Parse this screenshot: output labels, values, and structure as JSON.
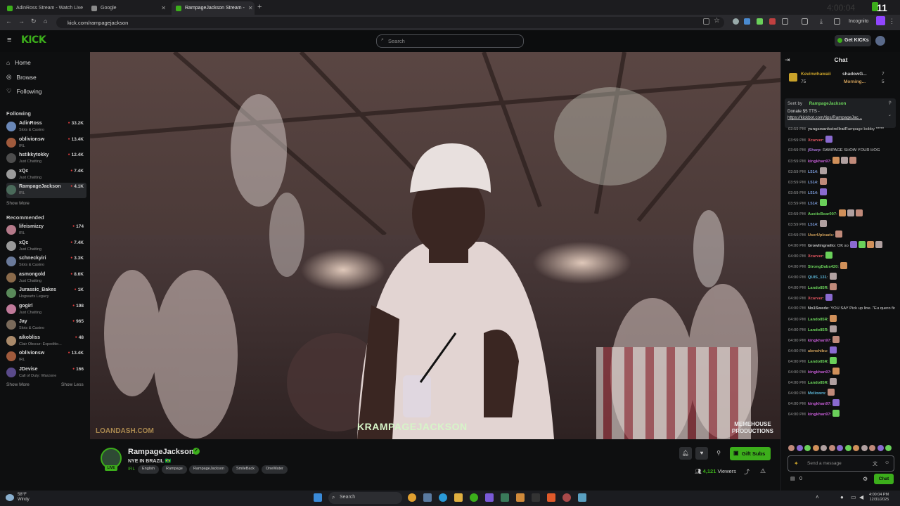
{
  "browser": {
    "tabs": [
      {
        "title": "AdinRoss Stream - Watch Live",
        "active": false,
        "favicon_color": "#3cae1b"
      },
      {
        "title": "Google",
        "active": false,
        "favicon_color": "#8a8a8a"
      },
      {
        "title": "RampageJackson Stream - ",
        "active": true,
        "favicon_color": "#3cae1b"
      }
    ],
    "url": "kick.com/rampagejackson",
    "incognito_label": "Incognito",
    "overlay_number": "11",
    "overlay_clock": "4:00:04"
  },
  "header": {
    "logo": "KICK",
    "search_placeholder": "Search",
    "get_kicks_label": "Get KICKs"
  },
  "sidebar": {
    "nav": [
      {
        "label": "Home",
        "icon": "home-icon"
      },
      {
        "label": "Browse",
        "icon": "browse-icon"
      },
      {
        "label": "Following",
        "icon": "heart-icon"
      }
    ],
    "following_title": "Following",
    "following": [
      {
        "name": "AdinRoss",
        "category": "Slots & Casino",
        "viewers": "33.2K",
        "color": "#6a88b8"
      },
      {
        "name": "oblivionsw",
        "category": "IRL",
        "viewers": "13.4K",
        "color": "#a05a3c"
      },
      {
        "name": "hstikkytokky",
        "category": "Just Chatting",
        "viewers": "12.4K",
        "color": "#4d4d4d"
      },
      {
        "name": "xQc",
        "category": "Just Chatting",
        "viewers": "7.4K",
        "color": "#9a9a9a"
      },
      {
        "name": "RampageJackson",
        "category": "IRL",
        "viewers": "4.1K",
        "color": "#4a6a5a"
      }
    ],
    "show_more": "Show More",
    "recommended_title": "Recommended",
    "recommended": [
      {
        "name": "lifeismizzy",
        "category": "IRL",
        "viewers": "174",
        "color": "#b57a8a"
      },
      {
        "name": "xQc",
        "category": "Just Chatting",
        "viewers": "7.4K",
        "color": "#9a9a9a"
      },
      {
        "name": "schneckyiri",
        "category": "Slots & Casino",
        "viewers": "3.3K",
        "color": "#6a7a9a"
      },
      {
        "name": "asmongold",
        "category": "Just Chatting",
        "viewers": "8.6K",
        "color": "#8a6a4a"
      },
      {
        "name": "Jurassic_Bakes",
        "category": "Hogwarts Legacy",
        "viewers": "1K",
        "color": "#5a8a5a"
      },
      {
        "name": "gogirl",
        "category": "Just Chatting",
        "viewers": "198",
        "color": "#c07a9a"
      },
      {
        "name": "Jay",
        "category": "Slots & Casino",
        "viewers": "965",
        "color": "#7a6a5a"
      },
      {
        "name": "aikobliss",
        "category": "Clair Obscur: Expeditio...",
        "viewers": "48",
        "color": "#aa8a6a"
      },
      {
        "name": "oblivionsw",
        "category": "IRL",
        "viewers": "13.4K",
        "color": "#a05a3c"
      },
      {
        "name": "JDevise",
        "category": "Call of Duty: Warzone",
        "viewers": "166",
        "color": "#5a4a8a"
      }
    ],
    "show_more_2": "Show More",
    "show_less": "Show Less"
  },
  "video": {
    "watermark_left": "LOANDASH.COM",
    "banner_center": "KRAMPAGEJACKSON",
    "watermark_right_line1": "MEMEHOUSE",
    "watermark_right_line2": "PRODUCTIONS"
  },
  "stream": {
    "name": "RampageJackson",
    "live_label": "LIVE",
    "title": "NYE IN BRAZIL 🇧🇷",
    "category": "IRL",
    "tags": [
      "English",
      "Rampage",
      "RampageJackson",
      "SmileBack",
      "OneWater"
    ],
    "gift_subs_label": "Gift Subs",
    "viewers_count": "4,121",
    "viewers_label": "Viewers"
  },
  "chat": {
    "title": "Chat",
    "pinned": {
      "user1": "Kevinwhawaii",
      "user1_count": "75",
      "user1_value": "7",
      "user2": "shadowG...",
      "user3": "Morning...",
      "user3_value": "5"
    },
    "tts": {
      "sent_by": "Sent by",
      "sender": "RampageJackson",
      "line1": "Donate $5 TTS -",
      "link": "https://kickbot.com/tips/RampageJac..."
    },
    "messages": [
      {
        "time": "03:59 PM",
        "user": "yungswankstrellrat",
        "text": "Rampage bobby *****",
        "color": "#bdbdbd",
        "emotes": 0
      },
      {
        "time": "03:59 PM",
        "user": "Xcarver",
        "text": ":",
        "color": "#e0545e",
        "emotes": 1
      },
      {
        "time": "03:59 PM",
        "user": "jSharp",
        "text": ": RAMPAGE SHOW YOUR HOG",
        "color": "#a070d0",
        "emotes": 0
      },
      {
        "time": "03:59 PM",
        "user": "kingkhan97",
        "text": ":",
        "color": "#c05ad0",
        "emotes": 3
      },
      {
        "time": "03:59 PM",
        "user": "L514",
        "text": ":",
        "color": "#7a9ad8",
        "emotes": 1
      },
      {
        "time": "03:59 PM",
        "user": "L514",
        "text": ":",
        "color": "#7a9ad8",
        "emotes": 1
      },
      {
        "time": "03:59 PM",
        "user": "L514",
        "text": ":",
        "color": "#7a9ad8",
        "emotes": 1
      },
      {
        "time": "03:59 PM",
        "user": "L514",
        "text": ":",
        "color": "#7a9ad8",
        "emotes": 1
      },
      {
        "time": "03:59 PM",
        "user": "AusticBear007",
        "text": ":",
        "color": "#6ad05a",
        "emotes": 3
      },
      {
        "time": "03:59 PM",
        "user": "L514",
        "text": ":",
        "color": "#7a9ad8",
        "emotes": 1
      },
      {
        "time": "03:59 PM",
        "user": "UserUploads",
        "text": ":",
        "color": "#d0a05a",
        "emotes": 1
      },
      {
        "time": "04:00 PM",
        "user": "Growlingnello",
        "text": ": OK so",
        "color": "#bdbdbd",
        "emotes": 4
      },
      {
        "time": "04:00 PM",
        "user": "Xcarver",
        "text": ":",
        "color": "#e0545e",
        "emotes": 1
      },
      {
        "time": "04:00 PM",
        "user": "StrongDabs420",
        "text": ":",
        "color": "#6ad05a",
        "emotes": 1
      },
      {
        "time": "04:00 PM",
        "user": "QUIS_131",
        "text": ":",
        "color": "#5ab0d0",
        "emotes": 1
      },
      {
        "time": "04:00 PM",
        "user": "Lando85R",
        "text": ":",
        "color": "#6ad05a",
        "emotes": 1
      },
      {
        "time": "04:00 PM",
        "user": "Xcarver",
        "text": ":",
        "color": "#e0545e",
        "emotes": 1
      },
      {
        "time": "04:00 PM",
        "user": "No1Swede",
        "text": ": YOU SAY Pick up line..\"Eu quero ficar com voce\"",
        "color": "#bdbdbd",
        "emotes": 0
      },
      {
        "time": "04:00 PM",
        "user": "Lando85R",
        "text": ":",
        "color": "#6ad05a",
        "emotes": 1
      },
      {
        "time": "04:00 PM",
        "user": "Lando85R",
        "text": ":",
        "color": "#6ad05a",
        "emotes": 1
      },
      {
        "time": "04:00 PM",
        "user": "kingkhan97",
        "text": ":",
        "color": "#c05ad0",
        "emotes": 1
      },
      {
        "time": "04:00 PM",
        "user": "alenshibu",
        "text": ":",
        "color": "#d0a05a",
        "emotes": 1
      },
      {
        "time": "04:00 PM",
        "user": "Lando85R",
        "text": ":",
        "color": "#6ad05a",
        "emotes": 1
      },
      {
        "time": "04:00 PM",
        "user": "kingkhan97",
        "text": ":",
        "color": "#c05ad0",
        "emotes": 1
      },
      {
        "time": "04:00 PM",
        "user": "Lando85R",
        "text": ":",
        "color": "#6ad05a",
        "emotes": 1
      },
      {
        "time": "04:00 PM",
        "user": "Meliowrs",
        "text": ":",
        "color": "#5ab0d0",
        "emotes": 1
      },
      {
        "time": "04:00 PM",
        "user": "kingkhan97",
        "text": ":",
        "color": "#c05ad0",
        "emotes": 1
      },
      {
        "time": "04:00 PM",
        "user": "kingkhan97",
        "text": ":",
        "color": "#c05ad0",
        "emotes": 1
      }
    ],
    "input_placeholder": "Send a message",
    "points": "0",
    "send_label": "Chat"
  },
  "taskbar": {
    "temp": "58°F",
    "weather": "Windy",
    "search_placeholder": "Search",
    "time": "4:00:04 PM",
    "date": "12/31/2025"
  },
  "colors": {
    "accent": "#3cae1b",
    "live": "#e03e3e"
  }
}
